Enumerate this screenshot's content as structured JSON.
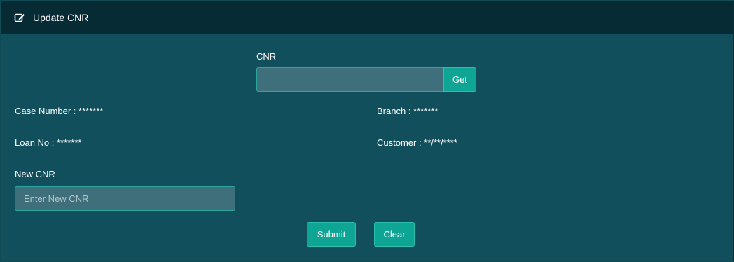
{
  "header": {
    "icon": "edit-icon",
    "title": "Update CNR"
  },
  "cnr": {
    "label": "CNR",
    "value": "",
    "placeholder": "",
    "get_label": "Get"
  },
  "details": {
    "case_number": "Case Number : *******",
    "branch": "Branch : *******",
    "loan_no": "Loan No : *******",
    "customer": "Customer : **/**/****"
  },
  "new_cnr": {
    "label": "New CNR",
    "value": "",
    "placeholder": "Enter New CNR"
  },
  "actions": {
    "submit_label": "Submit",
    "clear_label": "Clear"
  },
  "colors": {
    "panel_bg": "#124f5c",
    "header_bg": "#062b35",
    "input_bg": "#3e6f7a",
    "accent": "#0ea595"
  }
}
